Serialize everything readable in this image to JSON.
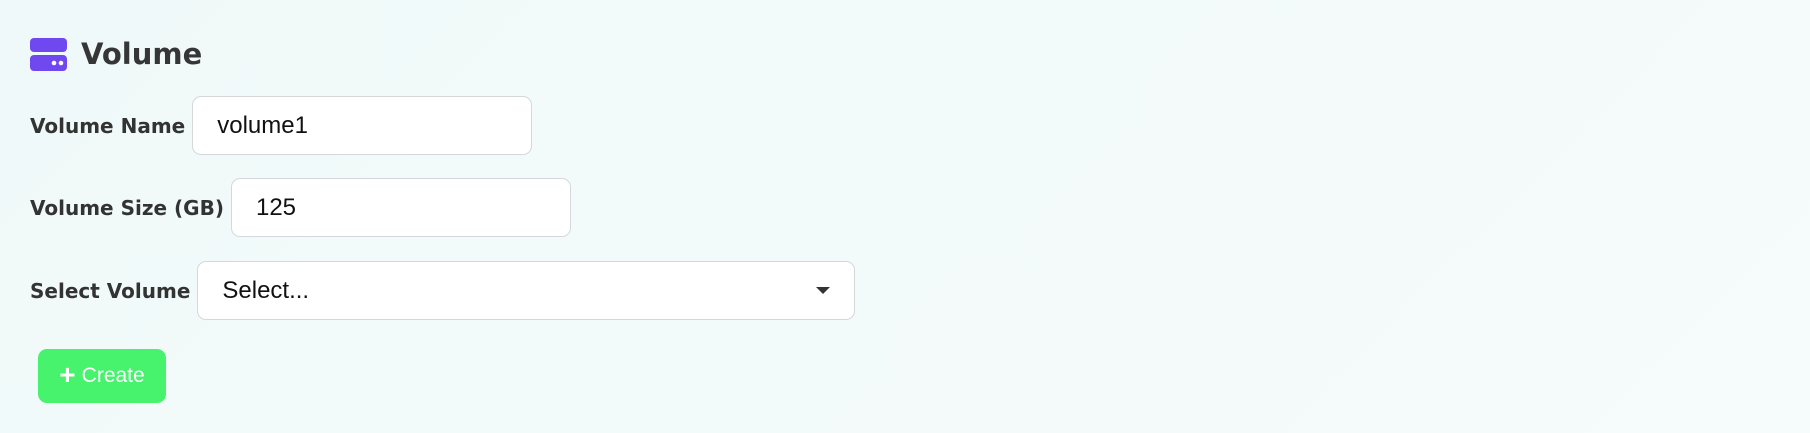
{
  "header": {
    "title": "Volume",
    "icon": "hard-drive-icon",
    "icon_color": "#7048f0"
  },
  "form": {
    "volume_name": {
      "label": "Volume Name",
      "value": "volume1"
    },
    "volume_size": {
      "label": "Volume Size (GB)",
      "value": "125"
    },
    "select_volume": {
      "label": "Select Volume",
      "selected": "Select..."
    }
  },
  "actions": {
    "create_label": "Create",
    "create_icon": "plus-icon",
    "create_color": "#47f26d"
  }
}
